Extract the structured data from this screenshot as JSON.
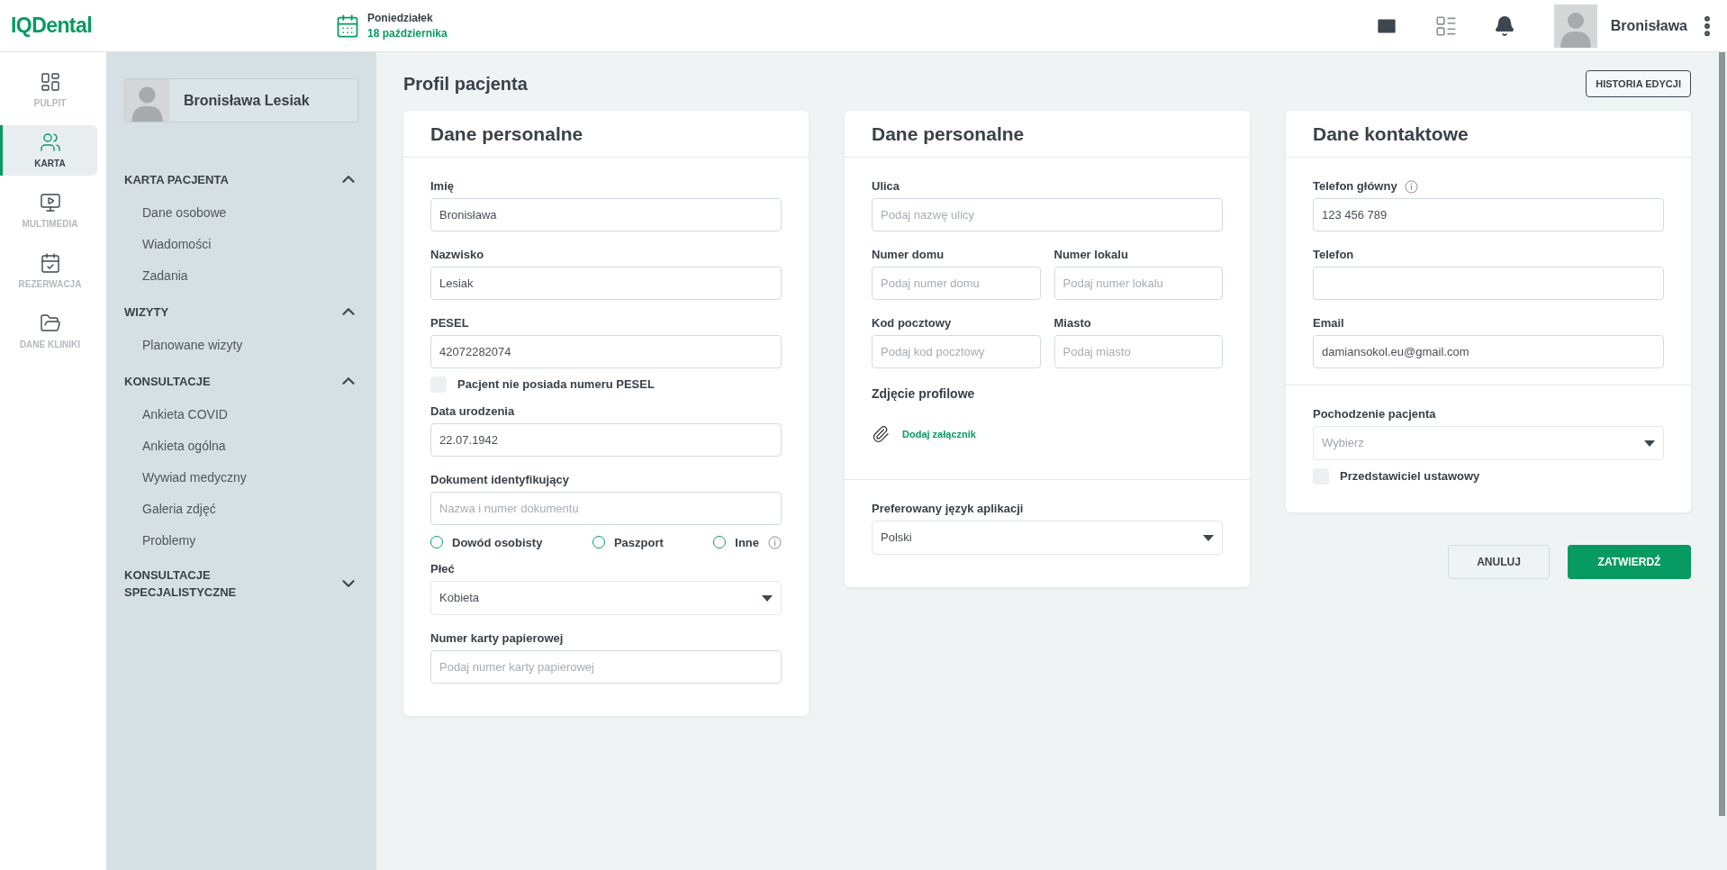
{
  "header": {
    "logo": "IQDental",
    "day": "Poniedziałek",
    "date": "18 października",
    "user_name": "Bronisława"
  },
  "rail": [
    {
      "label": "PULPIT",
      "selected": false
    },
    {
      "label": "KARTA",
      "selected": true
    },
    {
      "label": "MULTIMEDIA",
      "selected": false
    },
    {
      "label": "REZERWACJA",
      "selected": false
    },
    {
      "label": "DANE KLINIKI",
      "selected": false
    }
  ],
  "patient": {
    "name": "Bronisława Lesiak"
  },
  "nav_sections": [
    {
      "title": "KARTA PACJENTA",
      "expanded": true,
      "items": [
        "Dane osobowe",
        "Wiadomości",
        "Zadania"
      ]
    },
    {
      "title": "WIZYTY",
      "expanded": true,
      "items": [
        "Planowane wizyty"
      ]
    },
    {
      "title": "KONSULTACJE",
      "expanded": true,
      "items": [
        "Ankieta COVID",
        "Ankieta ogólna",
        "Wywiad medyczny",
        "Galeria zdjęć",
        "Problemy"
      ]
    },
    {
      "title": "KONSULTACJE SPECJALISTYCZNE",
      "expanded": false
    }
  ],
  "page_title": "Profil pacjenta",
  "history_button": "HISTORIA EDYCJI",
  "cards": [
    {
      "title": "Dane personalne",
      "sections": [
        [
          {
            "kind": "input",
            "label": "Imię",
            "value": "Bronisława"
          },
          {
            "kind": "input",
            "label": "Nazwisko",
            "value": "Lesiak"
          },
          {
            "kind": "input",
            "label": "PESEL",
            "value": "42072282074"
          },
          {
            "kind": "checkbox",
            "label": "Pacjent nie posiada numeru PESEL",
            "checked": false
          },
          {
            "kind": "input",
            "label": "Data urodzenia",
            "value": "22.07.1942"
          },
          {
            "kind": "input",
            "label": "Dokument identyfikujący",
            "placeholder": "Nazwa i numer dokumentu"
          },
          {
            "kind": "radios",
            "options": [
              {
                "label": "Dowód osobisty",
                "selected": false
              },
              {
                "label": "Paszport",
                "selected": false
              },
              {
                "label": "Inne",
                "selected": false,
                "info": true
              }
            ]
          },
          {
            "kind": "select",
            "label": "Płeć",
            "value": "Kobieta"
          },
          {
            "kind": "input",
            "label": "Numer karty papierowej",
            "placeholder": "Podaj numer karty papierowej"
          }
        ]
      ]
    },
    {
      "title": "Dane personalne",
      "sections": [
        [
          {
            "kind": "input",
            "label": "Ulica",
            "placeholder": "Podaj nazwę ulicy"
          },
          {
            "kind": "pair",
            "fields": [
              {
                "label": "Numer domu",
                "placeholder": "Podaj numer domu"
              },
              {
                "label": "Numer lokalu",
                "placeholder": "Podaj numer lokalu"
              }
            ]
          },
          {
            "kind": "pair",
            "fields": [
              {
                "label": "Kod pocztowy",
                "placeholder": "Podaj kod pocztowy"
              },
              {
                "label": "Miasto",
                "placeholder": "Podaj miasto"
              }
            ]
          },
          {
            "kind": "attachment",
            "label": "Zdjęcie profilowe",
            "link": "Dodaj załącznik"
          }
        ],
        [
          {
            "kind": "select",
            "label": "Preferowany język aplikacji",
            "value": "Polski"
          }
        ]
      ]
    },
    {
      "title": "Dane kontaktowe",
      "sections": [
        [
          {
            "kind": "input",
            "label": "Telefon główny",
            "value": "123 456 789",
            "info": true
          },
          {
            "kind": "input",
            "label": "Telefon"
          },
          {
            "kind": "input",
            "label": "Email",
            "value": "damiansokol.eu@gmail.com"
          }
        ],
        [
          {
            "kind": "select",
            "label": "Pochodzenie pacjenta",
            "placeholder": "Wybierz"
          },
          {
            "kind": "checkbox",
            "label": "Przedstawiciel ustawowy",
            "checked": false
          }
        ]
      ]
    }
  ],
  "buttons": {
    "cancel": "ANULUJ",
    "confirm": "ZATWIERDŹ"
  }
}
